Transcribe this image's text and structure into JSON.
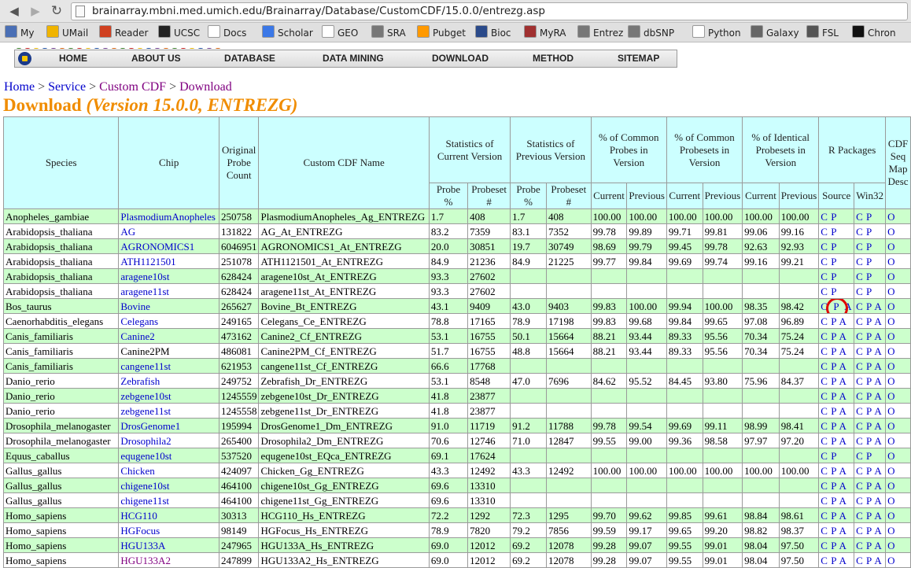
{
  "browser": {
    "url": "brainarray.mbni.med.umich.edu/Brainarray/Database/CustomCDF/15.0.0/entrezg.asp",
    "bookmarks": [
      {
        "label": "My",
        "color": "#4a6fb5"
      },
      {
        "label": "UMail",
        "color": "#f0b400"
      },
      {
        "label": "Reader",
        "color": "#d04020"
      },
      {
        "label": "UCSC",
        "color": "#222222"
      },
      {
        "label": "Docs",
        "color": "#ffffff"
      },
      {
        "label": "Scholar",
        "color": "#3b78e7"
      },
      {
        "label": "GEO",
        "color": "#ffffff"
      },
      {
        "label": "SRA",
        "color": "#777777"
      },
      {
        "label": "Pubget",
        "color": "#ff9900"
      },
      {
        "label": "Bioc",
        "color": "#2a4a8a"
      },
      {
        "label": "MyRA",
        "color": "#a03030"
      },
      {
        "label": "Entrez",
        "color": "#777777"
      },
      {
        "label": "dbSNP",
        "color": "#777777"
      },
      {
        "label": "Python",
        "color": "#ffffff"
      },
      {
        "label": "Galaxy",
        "color": "#666666"
      },
      {
        "label": "FSL",
        "color": "#555555"
      },
      {
        "label": "Chron",
        "color": "#111111"
      }
    ]
  },
  "sitenav": [
    "HOME",
    "ABOUT US",
    "DATABASE",
    "DATA MINING",
    "DOWNLOAD",
    "METHOD",
    "SITEMAP"
  ],
  "breadcrumb": {
    "home": "Home",
    "service": "Service",
    "custom": "Custom CDF",
    "download": "Download",
    "sep": " > "
  },
  "title": {
    "main": "Download ",
    "version": "(Version 15.0.0, ENTREZG)"
  },
  "headers": {
    "species": "Species",
    "chip": "Chip",
    "original": "Original Probe Count",
    "custom": "Custom CDF Name",
    "stat_current": "Statistics of Current Version",
    "stat_previous": "Statistics of Previous Version",
    "pct_probes": "% of Common Probes in Version",
    "pct_probesets": "% of Common Probesets in Version",
    "pct_identical": "% of Identical Probesets in Version",
    "rpackages": "R Packages",
    "cdfseq": "CDF Seq Map Desc",
    "probe_pct": "Probe %",
    "probeset_num": "Probeset #",
    "current": "Current",
    "previous": "Previous",
    "source": "Source",
    "win32": "Win32"
  },
  "rows": [
    {
      "species": "Anopheles_gambiae",
      "chip": "PlasmodiumAnopheles",
      "opc": "250758",
      "cdf": "PlasmodiumAnopheles_Ag_ENTREZG",
      "cp": "1.7",
      "cps": "408",
      "pp": "1.7",
      "pps": "408",
      "a1": "100.00",
      "a2": "100.00",
      "b1": "100.00",
      "b2": "100.00",
      "c1": "100.00",
      "c2": "100.00",
      "src": "C P",
      "win": "C P",
      "o": "O"
    },
    {
      "species": "Arabidopsis_thaliana",
      "chip": "AG",
      "opc": "131822",
      "cdf": "AG_At_ENTREZG",
      "cp": "83.2",
      "cps": "7359",
      "pp": "83.1",
      "pps": "7352",
      "a1": "99.78",
      "a2": "99.89",
      "b1": "99.71",
      "b2": "99.81",
      "c1": "99.06",
      "c2": "99.16",
      "src": "C P",
      "win": "C P",
      "o": "O"
    },
    {
      "species": "Arabidopsis_thaliana",
      "chip": "AGRONOMICS1",
      "opc": "6046951",
      "cdf": "AGRONOMICS1_At_ENTREZG",
      "cp": "20.0",
      "cps": "30851",
      "pp": "19.7",
      "pps": "30749",
      "a1": "98.69",
      "a2": "99.79",
      "b1": "99.45",
      "b2": "99.78",
      "c1": "92.63",
      "c2": "92.93",
      "src": "C P",
      "win": "C P",
      "o": "O"
    },
    {
      "species": "Arabidopsis_thaliana",
      "chip": "ATH1121501",
      "opc": "251078",
      "cdf": "ATH1121501_At_ENTREZG",
      "cp": "84.9",
      "cps": "21236",
      "pp": "84.9",
      "pps": "21225",
      "a1": "99.77",
      "a2": "99.84",
      "b1": "99.69",
      "b2": "99.74",
      "c1": "99.16",
      "c2": "99.21",
      "src": "C P",
      "win": "C P",
      "o": "O"
    },
    {
      "species": "Arabidopsis_thaliana",
      "chip": "aragene10st",
      "opc": "628424",
      "cdf": "aragene10st_At_ENTREZG",
      "cp": "93.3",
      "cps": "27602",
      "pp": "",
      "pps": "",
      "a1": "",
      "a2": "",
      "b1": "",
      "b2": "",
      "c1": "",
      "c2": "",
      "src": "C P",
      "win": "C P",
      "o": "O"
    },
    {
      "species": "Arabidopsis_thaliana",
      "chip": "aragene11st",
      "opc": "628424",
      "cdf": "aragene11st_At_ENTREZG",
      "cp": "93.3",
      "cps": "27602",
      "pp": "",
      "pps": "",
      "a1": "",
      "a2": "",
      "b1": "",
      "b2": "",
      "c1": "",
      "c2": "",
      "src": "C P",
      "win": "C P",
      "o": "O"
    },
    {
      "species": "Bos_taurus",
      "chip": "Bovine",
      "opc": "265627",
      "cdf": "Bovine_Bt_ENTREZG",
      "cp": "43.1",
      "cps": "9409",
      "pp": "43.0",
      "pps": "9403",
      "a1": "99.83",
      "a2": "100.00",
      "b1": "99.94",
      "b2": "100.00",
      "c1": "98.35",
      "c2": "98.42",
      "src": "C P A",
      "win": "C P A",
      "o": "O",
      "highlight": true
    },
    {
      "species": "Caenorhabditis_elegans",
      "chip": "Celegans",
      "opc": "249165",
      "cdf": "Celegans_Ce_ENTREZG",
      "cp": "78.8",
      "cps": "17165",
      "pp": "78.9",
      "pps": "17198",
      "a1": "99.83",
      "a2": "99.68",
      "b1": "99.84",
      "b2": "99.65",
      "c1": "97.08",
      "c2": "96.89",
      "src": "C P A",
      "win": "C P A",
      "o": "O"
    },
    {
      "species": "Canis_familiaris",
      "chip": "Canine2",
      "opc": "473162",
      "cdf": "Canine2_Cf_ENTREZG",
      "cp": "53.1",
      "cps": "16755",
      "pp": "50.1",
      "pps": "15664",
      "a1": "88.21",
      "a2": "93.44",
      "b1": "89.33",
      "b2": "95.56",
      "c1": "70.34",
      "c2": "75.24",
      "src": "C P A",
      "win": "C P A",
      "o": "O"
    },
    {
      "species": "Canis_familiaris",
      "chip": "Canine2PM",
      "opc": "486081",
      "cdf": "Canine2PM_Cf_ENTREZG",
      "cp": "51.7",
      "cps": "16755",
      "pp": "48.8",
      "pps": "15664",
      "a1": "88.21",
      "a2": "93.44",
      "b1": "89.33",
      "b2": "95.56",
      "c1": "70.34",
      "c2": "75.24",
      "src": "C P A",
      "win": "C P A",
      "o": "O",
      "plainchip": true
    },
    {
      "species": "Canis_familiaris",
      "chip": "cangene11st",
      "opc": "621953",
      "cdf": "cangene11st_Cf_ENTREZG",
      "cp": "66.6",
      "cps": "17768",
      "pp": "",
      "pps": "",
      "a1": "",
      "a2": "",
      "b1": "",
      "b2": "",
      "c1": "",
      "c2": "",
      "src": "C P A",
      "win": "C P A",
      "o": "O"
    },
    {
      "species": "Danio_rerio",
      "chip": "Zebrafish",
      "opc": "249752",
      "cdf": "Zebrafish_Dr_ENTREZG",
      "cp": "53.1",
      "cps": "8548",
      "pp": "47.0",
      "pps": "7696",
      "a1": "84.62",
      "a2": "95.52",
      "b1": "84.45",
      "b2": "93.80",
      "c1": "75.96",
      "c2": "84.37",
      "src": "C P A",
      "win": "C P A",
      "o": "O"
    },
    {
      "species": "Danio_rerio",
      "chip": "zebgene10st",
      "opc": "1245559",
      "cdf": "zebgene10st_Dr_ENTREZG",
      "cp": "41.8",
      "cps": "23877",
      "pp": "",
      "pps": "",
      "a1": "",
      "a2": "",
      "b1": "",
      "b2": "",
      "c1": "",
      "c2": "",
      "src": "C P A",
      "win": "C P A",
      "o": "O"
    },
    {
      "species": "Danio_rerio",
      "chip": "zebgene11st",
      "opc": "1245558",
      "cdf": "zebgene11st_Dr_ENTREZG",
      "cp": "41.8",
      "cps": "23877",
      "pp": "",
      "pps": "",
      "a1": "",
      "a2": "",
      "b1": "",
      "b2": "",
      "c1": "",
      "c2": "",
      "src": "C P A",
      "win": "C P A",
      "o": "O"
    },
    {
      "species": "Drosophila_melanogaster",
      "chip": "DrosGenome1",
      "opc": "195994",
      "cdf": "DrosGenome1_Dm_ENTREZG",
      "cp": "91.0",
      "cps": "11719",
      "pp": "91.2",
      "pps": "11788",
      "a1": "99.78",
      "a2": "99.54",
      "b1": "99.69",
      "b2": "99.11",
      "c1": "98.99",
      "c2": "98.41",
      "src": "C P A",
      "win": "C P A",
      "o": "O"
    },
    {
      "species": "Drosophila_melanogaster",
      "chip": "Drosophila2",
      "opc": "265400",
      "cdf": "Drosophila2_Dm_ENTREZG",
      "cp": "70.6",
      "cps": "12746",
      "pp": "71.0",
      "pps": "12847",
      "a1": "99.55",
      "a2": "99.00",
      "b1": "99.36",
      "b2": "98.58",
      "c1": "97.97",
      "c2": "97.20",
      "src": "C P A",
      "win": "C P A",
      "o": "O"
    },
    {
      "species": "Equus_caballus",
      "chip": "equgene10st",
      "opc": "537520",
      "cdf": "equgene10st_EQca_ENTREZG",
      "cp": "69.1",
      "cps": "17624",
      "pp": "",
      "pps": "",
      "a1": "",
      "a2": "",
      "b1": "",
      "b2": "",
      "c1": "",
      "c2": "",
      "src": "C P",
      "win": "C P",
      "o": "O"
    },
    {
      "species": "Gallus_gallus",
      "chip": "Chicken",
      "opc": "424097",
      "cdf": "Chicken_Gg_ENTREZG",
      "cp": "43.3",
      "cps": "12492",
      "pp": "43.3",
      "pps": "12492",
      "a1": "100.00",
      "a2": "100.00",
      "b1": "100.00",
      "b2": "100.00",
      "c1": "100.00",
      "c2": "100.00",
      "src": "C P A",
      "win": "C P A",
      "o": "O"
    },
    {
      "species": "Gallus_gallus",
      "chip": "chigene10st",
      "opc": "464100",
      "cdf": "chigene10st_Gg_ENTREZG",
      "cp": "69.6",
      "cps": "13310",
      "pp": "",
      "pps": "",
      "a1": "",
      "a2": "",
      "b1": "",
      "b2": "",
      "c1": "",
      "c2": "",
      "src": "C P A",
      "win": "C P A",
      "o": "O"
    },
    {
      "species": "Gallus_gallus",
      "chip": "chigene11st",
      "opc": "464100",
      "cdf": "chigene11st_Gg_ENTREZG",
      "cp": "69.6",
      "cps": "13310",
      "pp": "",
      "pps": "",
      "a1": "",
      "a2": "",
      "b1": "",
      "b2": "",
      "c1": "",
      "c2": "",
      "src": "C P A",
      "win": "C P A",
      "o": "O"
    },
    {
      "species": "Homo_sapiens",
      "chip": "HCG110",
      "opc": "30313",
      "cdf": "HCG110_Hs_ENTREZG",
      "cp": "72.2",
      "cps": "1292",
      "pp": "72.3",
      "pps": "1295",
      "a1": "99.70",
      "a2": "99.62",
      "b1": "99.85",
      "b2": "99.61",
      "c1": "98.84",
      "c2": "98.61",
      "src": "C P A",
      "win": "C P A",
      "o": "O"
    },
    {
      "species": "Homo_sapiens",
      "chip": "HGFocus",
      "opc": "98149",
      "cdf": "HGFocus_Hs_ENTREZG",
      "cp": "78.9",
      "cps": "7820",
      "pp": "79.2",
      "pps": "7856",
      "a1": "99.59",
      "a2": "99.17",
      "b1": "99.65",
      "b2": "99.20",
      "c1": "98.82",
      "c2": "98.37",
      "src": "C P A",
      "win": "C P A",
      "o": "O"
    },
    {
      "species": "Homo_sapiens",
      "chip": "HGU133A",
      "opc": "247965",
      "cdf": "HGU133A_Hs_ENTREZG",
      "cp": "69.0",
      "cps": "12012",
      "pp": "69.2",
      "pps": "12078",
      "a1": "99.28",
      "a2": "99.07",
      "b1": "99.55",
      "b2": "99.01",
      "c1": "98.04",
      "c2": "97.50",
      "src": "C P A",
      "win": "C P A",
      "o": "O"
    },
    {
      "species": "Homo_sapiens",
      "chip": "HGU133A2",
      "opc": "247899",
      "cdf": "HGU133A2_Hs_ENTREZG",
      "cp": "69.0",
      "cps": "12012",
      "pp": "69.2",
      "pps": "12078",
      "a1": "99.28",
      "a2": "99.07",
      "b1": "99.55",
      "b2": "99.01",
      "c1": "98.04",
      "c2": "97.50",
      "src": "C P A",
      "win": "C P A",
      "o": "O",
      "visited": true
    }
  ]
}
